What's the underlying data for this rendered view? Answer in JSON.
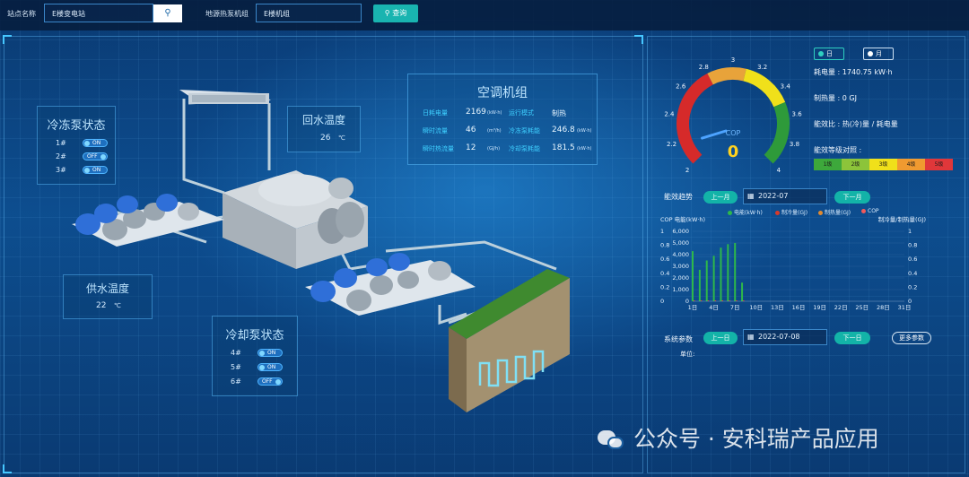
{
  "topbar": {
    "station_label": "站点名称",
    "station_value": "E楼变电站",
    "unit_label": "地源热泵机组",
    "unit_value": "E楼机组",
    "query_label": "查询"
  },
  "chilled_pump": {
    "title": "冷冻泵状态",
    "items": [
      {
        "name": "1#",
        "state": "ON"
      },
      {
        "name": "2#",
        "state": "OFF"
      },
      {
        "name": "3#",
        "state": "ON"
      }
    ]
  },
  "cooling_pump": {
    "title": "冷却泵状态",
    "items": [
      {
        "name": "4#",
        "state": "ON"
      },
      {
        "name": "5#",
        "state": "ON"
      },
      {
        "name": "6#",
        "state": "OFF"
      }
    ]
  },
  "return_temp": {
    "title": "回水温度",
    "value": "26",
    "unit": "℃"
  },
  "supply_temp": {
    "title": "供水温度",
    "value": "22",
    "unit": "℃"
  },
  "ac_unit": {
    "title": "空调机组",
    "r1": {
      "l1": "日耗电量",
      "v1": "2169",
      "u1": "(kW·h)",
      "l2": "运行模式",
      "v2": "制热"
    },
    "r2": {
      "l1": "瞬时流量",
      "v1": "46",
      "u1": "(m³/h)",
      "l2": "冷冻泵耗能",
      "v2": "246.8",
      "u2": "(kW·h)"
    },
    "r3": {
      "l1": "瞬时热流量",
      "v1": "12",
      "u1": "(GJ/h)",
      "l2": "冷却泵耗能",
      "v2": "181.5",
      "u2": "(kW·h)"
    }
  },
  "gauge": {
    "label": "COP",
    "value": "0",
    "ticks": [
      "2",
      "2.2",
      "2.4",
      "2.6",
      "2.8",
      "3",
      "3.2",
      "3.4",
      "3.6",
      "3.8",
      "4"
    ],
    "min": 2,
    "max": 4,
    "current": 0,
    "colors": [
      "#d62a2a",
      "#e8a33a",
      "#f0e01a",
      "#2e9a3a"
    ]
  },
  "period": {
    "day": "日",
    "month": "月",
    "selected": "day"
  },
  "stats": {
    "power": "耗电量 : 1740.75 kW·h",
    "heat": "制热量 : 0 GJ",
    "ratio": "能效比 : 热(冷)量 / 耗电量",
    "level_title": "能效等级对照 :",
    "levels": [
      "1级",
      "2级",
      "3级",
      "4级",
      "5级"
    ],
    "level_colors": [
      "#3da83b",
      "#8cc43a",
      "#f0e01a",
      "#f09a30",
      "#e0373a"
    ]
  },
  "trend": {
    "label": "能效趋势",
    "prev": "上一月",
    "date": "2022-07",
    "next": "下一月"
  },
  "chart_data": {
    "type": "bar",
    "legend": [
      {
        "name": "电能(kW·h)",
        "color": "#2eb84a"
      },
      {
        "name": "制冷量(GJ)",
        "color": "#d63a2a"
      },
      {
        "name": "制热量(GJ)",
        "color": "#e08a30"
      },
      {
        "name": "COP",
        "color": "#f25a5a"
      }
    ],
    "left_title": "COP 电能(kW·h)",
    "right_title": "制冷量/制热量(GJ)",
    "cop_ticks": [
      "1",
      "0.8",
      "0.6",
      "0.4",
      "0.2",
      "0"
    ],
    "left_ticks": [
      "6,000",
      "5,000",
      "4,000",
      "3,000",
      "2,000",
      "1,000",
      "0"
    ],
    "right_ticks": [
      "1",
      "0.8",
      "0.6",
      "0.4",
      "0.2",
      "0"
    ],
    "x_labels": [
      "1日",
      "4日",
      "7日",
      "10日",
      "13日",
      "16日",
      "19日",
      "22日",
      "25日",
      "28日",
      "31日"
    ],
    "days": [
      1,
      2,
      3,
      4,
      5,
      6,
      7,
      8,
      9,
      10,
      11,
      12,
      13,
      14,
      15,
      16,
      17,
      18,
      19,
      20,
      21,
      22,
      23,
      24,
      25,
      26,
      27,
      28,
      29,
      30,
      31
    ],
    "electric": [
      4300,
      2700,
      3500,
      3900,
      4600,
      4900,
      5000,
      1600,
      0,
      0,
      0,
      0,
      0,
      0,
      0,
      0,
      0,
      0,
      0,
      0,
      0,
      0,
      0,
      0,
      0,
      0,
      0,
      0,
      0,
      0,
      0
    ],
    "ylim": [
      0,
      6000
    ]
  },
  "system": {
    "label": "系统参数",
    "prev": "上一日",
    "date": "2022-07-08",
    "next": "下一日",
    "more": "更多参数",
    "unit_label": "单位:"
  },
  "watermark": "公众号 · 安科瑞产品应用"
}
